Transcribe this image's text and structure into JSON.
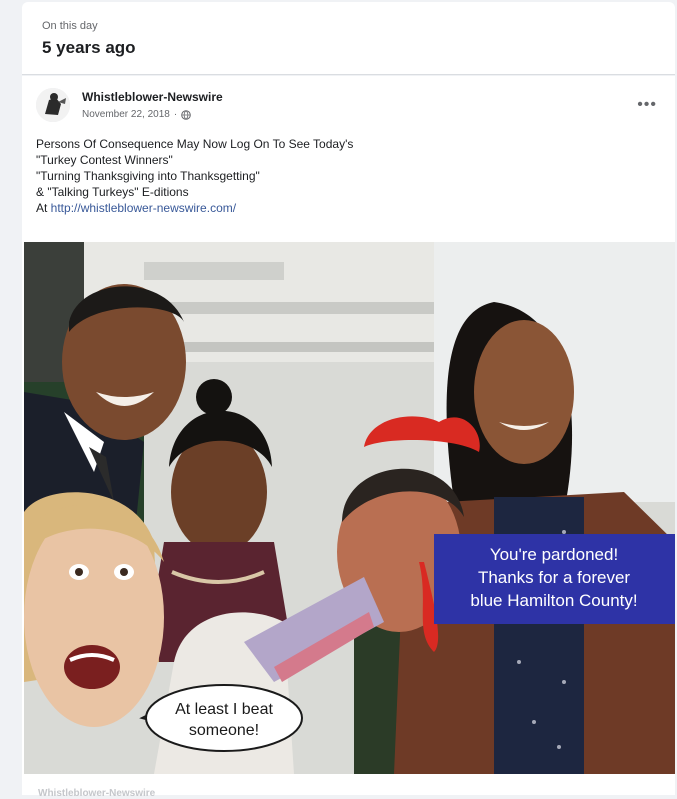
{
  "memory": {
    "label": "On this day",
    "title": "5 years ago"
  },
  "post": {
    "page_name": "Whistleblower-Newswire",
    "date": "November 22, 2018",
    "text_lines": [
      "Persons Of Consequence May Now Log On To See Today's",
      "\"Turkey Contest Winners\"",
      "\"Turning Thanksgiving into Thanksgetting\"",
      "& \"Talking Turkeys\" E-ditions"
    ],
    "link_prefix": "At ",
    "link_text": "http://whistleblower-newswire.com/",
    "more_label": "•••"
  },
  "image": {
    "blue_caption": [
      "You're pardoned!",
      "Thanks for a forever",
      "blue Hamilton County!"
    ],
    "bubble_caption": [
      "At least I beat",
      "someone!"
    ]
  },
  "footer": {
    "name_partial": "Whistleblower-Newswire"
  },
  "colors": {
    "background": "#f0f2f5",
    "card": "#ffffff",
    "link": "#385898",
    "caption_blue": "#2e33a6"
  },
  "icons": [
    "globe-icon",
    "more-options-icon",
    "page-avatar-icon"
  ]
}
